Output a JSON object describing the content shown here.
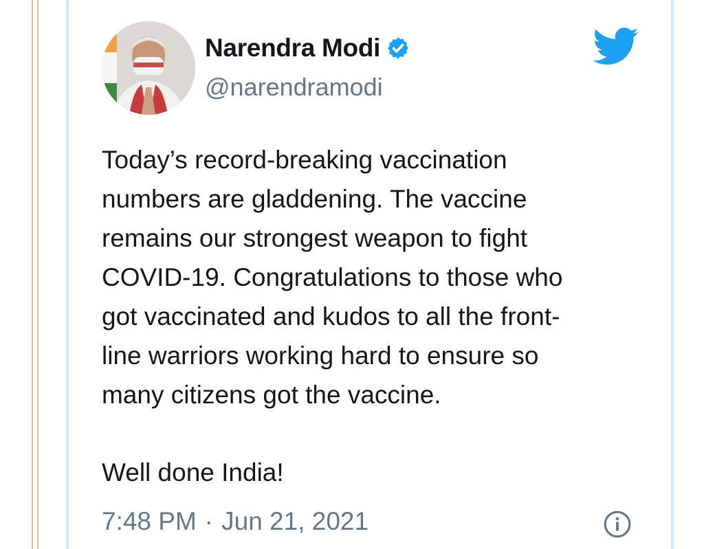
{
  "tweet": {
    "author": {
      "display_name": "Narendra Modi",
      "handle": "@narendramodi",
      "verified": true
    },
    "text_lines": [
      "Today’s record-breaking vaccination",
      "numbers are gladdening. The vaccine",
      "remains our strongest weapon to fight",
      "COVID-19. Congratulations to those who",
      "got vaccinated and kudos to all the front-",
      "line warriors working hard to ensure so",
      "many citizens got the vaccine."
    ],
    "closing_line": "Well done India!",
    "time": "7:48 PM",
    "separator": "·",
    "date": "Jun 21, 2021"
  },
  "icons": {
    "verified": "verified-badge-icon",
    "brand": "twitter-bird-icon",
    "info": "info-icon"
  },
  "colors": {
    "twitter_blue": "#1da1f2",
    "text_primary": "#14171a",
    "text_secondary": "#657786"
  }
}
